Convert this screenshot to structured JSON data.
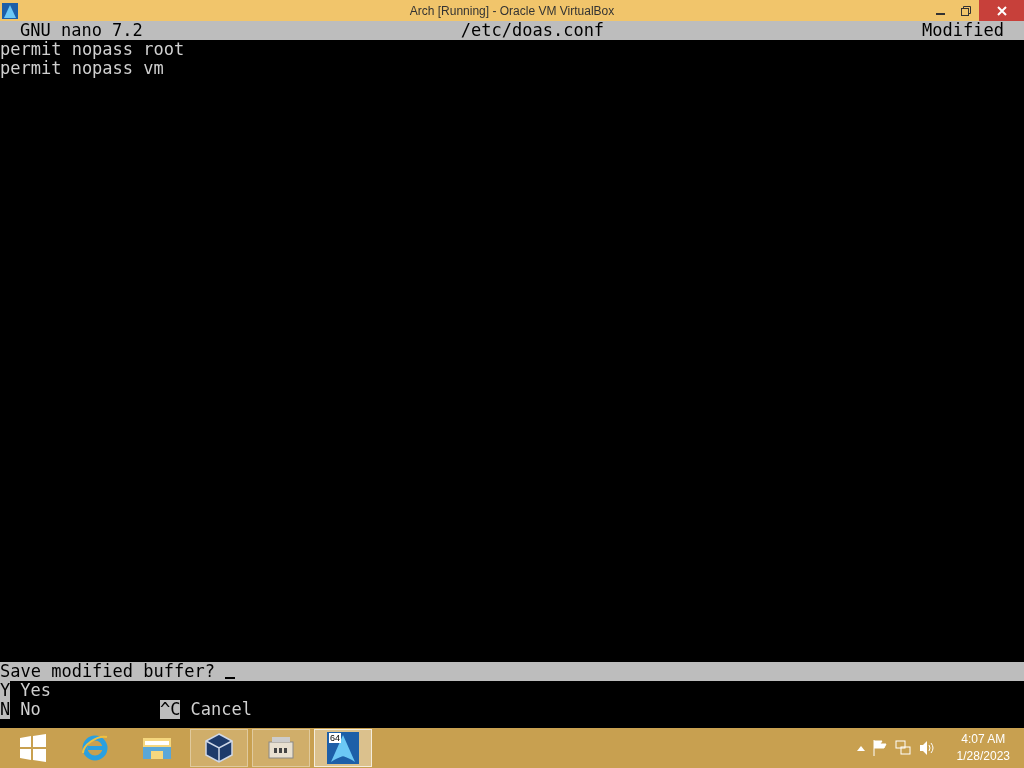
{
  "window": {
    "title": "Arch [Running] - Oracle VM VirtualBox"
  },
  "nano_header": {
    "version": "GNU nano 7.2",
    "filename": "/etc/doas.conf",
    "status": "Modified"
  },
  "buffer_lines": [
    "permit nopass root",
    "permit nopass vm"
  ],
  "prompt": {
    "text": "Save modified buffer?"
  },
  "options": [
    [
      {
        "key": "Y",
        "label": "Yes"
      }
    ],
    [
      {
        "key": "N",
        "label": "No"
      },
      {
        "key": "^C",
        "label": "Cancel"
      }
    ]
  ],
  "taskbar": {
    "items": [
      {
        "kind": "start",
        "open": false,
        "active": false
      },
      {
        "kind": "ie",
        "open": false,
        "active": false
      },
      {
        "kind": "explorer",
        "open": false,
        "active": false
      },
      {
        "kind": "virtualbox",
        "open": true,
        "active": false
      },
      {
        "kind": "device",
        "open": true,
        "active": false
      },
      {
        "kind": "arch",
        "open": true,
        "active": true,
        "badge": "64"
      }
    ],
    "time": "4:07 AM",
    "date": "1/28/2023"
  }
}
